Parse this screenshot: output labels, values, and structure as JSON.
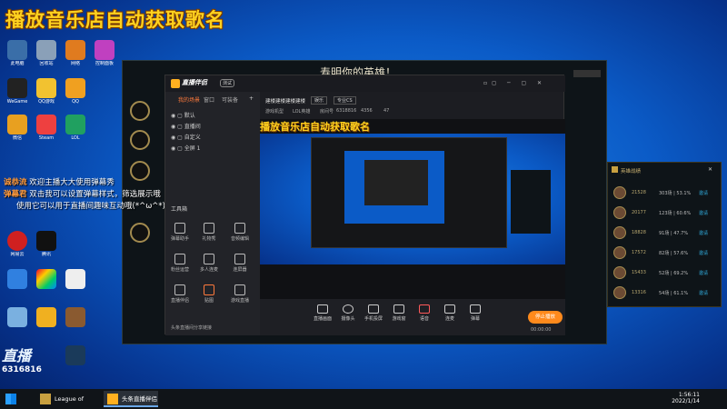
{
  "overlay": {
    "title": "播放音乐店自动获取歌名"
  },
  "chat": [
    {
      "user": "诚恭流",
      "text": "欢迎主播大大使用弹幕秀"
    },
    {
      "user": "弹幕君",
      "text": "双击我可以设置弹幕样式，筛选展示哦"
    },
    {
      "user": "",
      "text": "使用它可以用于直播间趣味互动哦(*^ω^*)"
    }
  ],
  "lol_window": {
    "title": "寿明你的英雄！"
  },
  "app": {
    "name": "直播伴侣",
    "badge": "测试",
    "left_tabs": [
      "我的场景",
      "窗口",
      "可装备"
    ],
    "scenes": [
      "默认",
      "直播间",
      "自定义",
      "全屏 1"
    ],
    "tools_title": "工具箱",
    "tools": [
      "弹幕助手",
      "礼物秀",
      "音频编辑",
      "粉丝运营",
      "多人连麦",
      "连屏器",
      "直播伴侣",
      "贴图",
      "游戏直播"
    ],
    "room_title": "建楼建楼建楼建楼",
    "room_tag": "娱乐",
    "room_category": "专业CS",
    "stats": [
      "游戏机型",
      "LOL英雄",
      "房间号",
      "6318816"
    ],
    "likes": "4356",
    "viewers": "47",
    "bottom_tools": [
      "直播画面",
      "摄像头",
      "手机投屏",
      "游戏窗",
      "语音",
      "连麦",
      "弹幕"
    ],
    "start_button": "停止播放",
    "timer": "00:00:00",
    "notice": "头条直播间分享链接"
  },
  "rank_panel": {
    "title": "英雄战绩",
    "rows": [
      {
        "score": "21528",
        "record": "303场 | 53.1%",
        "action": "邀请"
      },
      {
        "score": "20177",
        "record": "123场 | 60.6%",
        "action": "邀请"
      },
      {
        "score": "18828",
        "record": "91场 | 47.7%",
        "action": "邀请"
      },
      {
        "score": "17572",
        "record": "82场 | 57.6%",
        "action": "邀请"
      },
      {
        "score": "15433",
        "record": "52场 | 69.2%",
        "action": "邀请"
      },
      {
        "score": "13316",
        "record": "54场 | 61.1%",
        "action": "邀请"
      }
    ]
  },
  "watermark": {
    "brand": "直播",
    "id": "6316816"
  },
  "taskbar": {
    "apps": [
      "League of Legends",
      "头条直播伴侣"
    ],
    "time": "1:56:11",
    "date": "2022/1/14"
  },
  "desktop_icons": [
    "此电脑",
    "回收站",
    "网络",
    "控制面板",
    "WeGame",
    "QQ游戏",
    "QQ",
    "微信",
    "Steam",
    "LOL",
    "网易云",
    "腾讯"
  ]
}
